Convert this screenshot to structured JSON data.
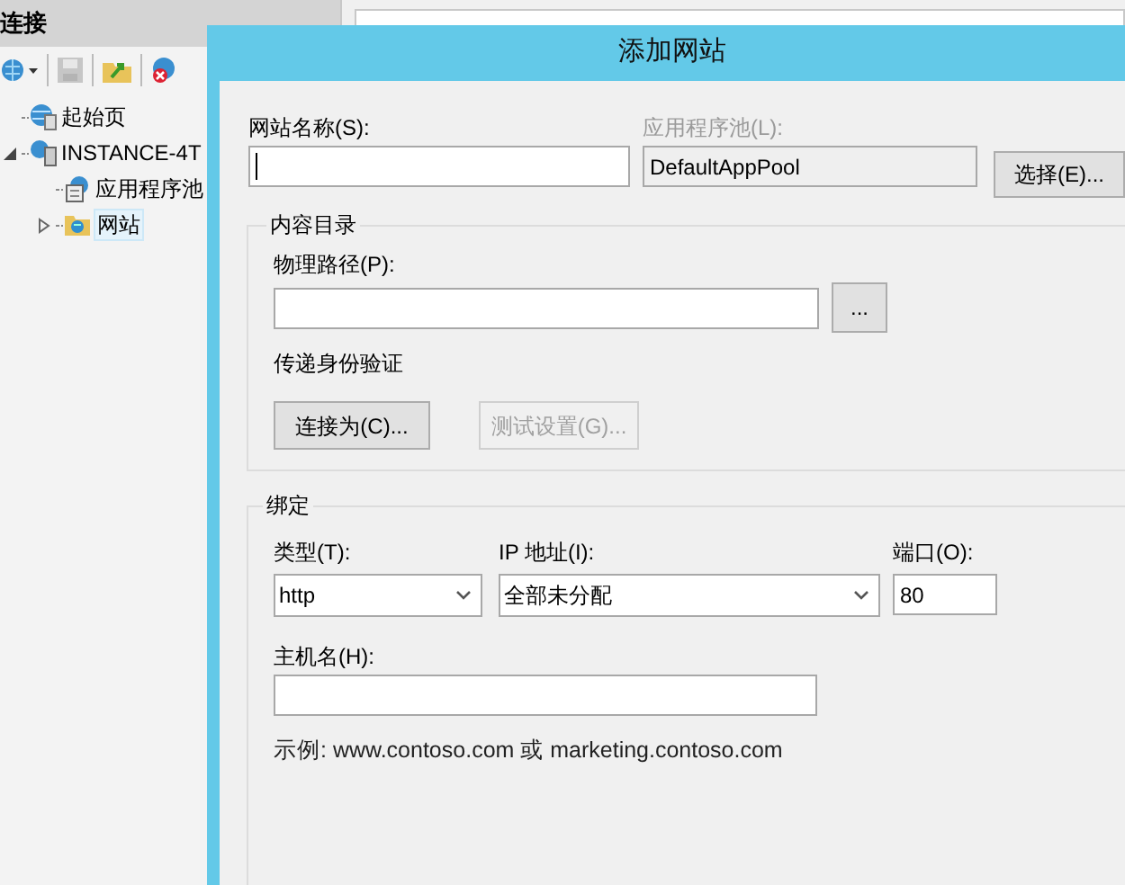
{
  "connections": {
    "title": "连接",
    "toolbar": [
      {
        "kind": "connect",
        "disabled": false
      },
      {
        "kind": "save",
        "disabled": true
      },
      {
        "kind": "up",
        "disabled": false
      },
      {
        "kind": "disconnect",
        "disabled": false
      }
    ],
    "tree": [
      {
        "label": "起始页",
        "kind": "start",
        "selected": false
      },
      {
        "label": "INSTANCE-4T",
        "kind": "server",
        "selected": false,
        "expanded": true,
        "children": [
          {
            "label": "应用程序池",
            "kind": "pools",
            "selected": false
          },
          {
            "label": "网站",
            "kind": "sites",
            "selected": true,
            "expanded": false
          }
        ]
      }
    ]
  },
  "dialog": {
    "title": "添加网站",
    "site_name": {
      "label": "网站名称(S):",
      "focused": true
    },
    "app_pool": {
      "label": "应用程序池(L):",
      "value": "DefaultAppPool",
      "disabled": true
    },
    "select_button": {
      "label": "选择(E)..."
    },
    "content_directory": {
      "title": "内容目录",
      "physical_path": {
        "label": "物理路径(P):"
      },
      "browse_button": {
        "label": "..."
      },
      "pass_through_auth": "传递身份验证",
      "buttons": [
        {
          "label": "连接为(C)...",
          "disabled": false
        },
        {
          "label": "测试设置(G)...",
          "disabled": true
        }
      ]
    },
    "binding": {
      "title": "绑定",
      "type": {
        "label": "类型(T):",
        "value": "http"
      },
      "ip_address": {
        "label": "IP 地址(I):",
        "value": "全部未分配"
      },
      "port": {
        "label": "端口(O):",
        "value": "80"
      },
      "host_name": {
        "label": "主机名(H):"
      },
      "example": "示例: www.contoso.com 或 marketing.contoso.com"
    }
  }
}
